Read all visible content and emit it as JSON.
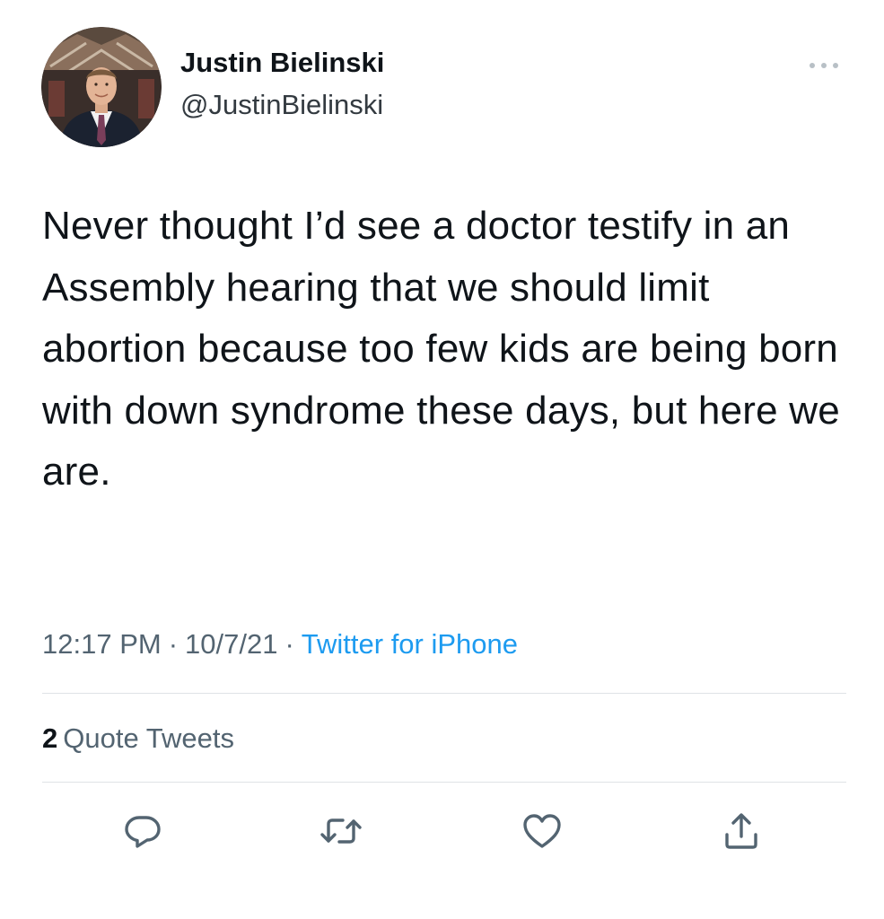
{
  "author": {
    "display_name": "Justin Bielinski",
    "handle": "@JustinBielinski"
  },
  "tweet": {
    "text": "Never thought I’d see a doctor testify in an Assembly hearing that we should limit abortion because too few kids are being born with down syndrome these days, but here we are.",
    "time": "12:17 PM",
    "date": "10/7/21",
    "separator": "·",
    "source": "Twitter for iPhone"
  },
  "stats": {
    "quote_count": "2",
    "quote_label": "Quote Tweets"
  },
  "icons": {
    "more": "more-horizontal-icon",
    "reply": "reply-icon",
    "retweet": "retweet-icon",
    "like": "heart-icon",
    "share": "share-icon"
  },
  "colors": {
    "text": "#0f1419",
    "secondary": "#536471",
    "link": "#1d9bf0",
    "divider": "#dfe3e6"
  }
}
